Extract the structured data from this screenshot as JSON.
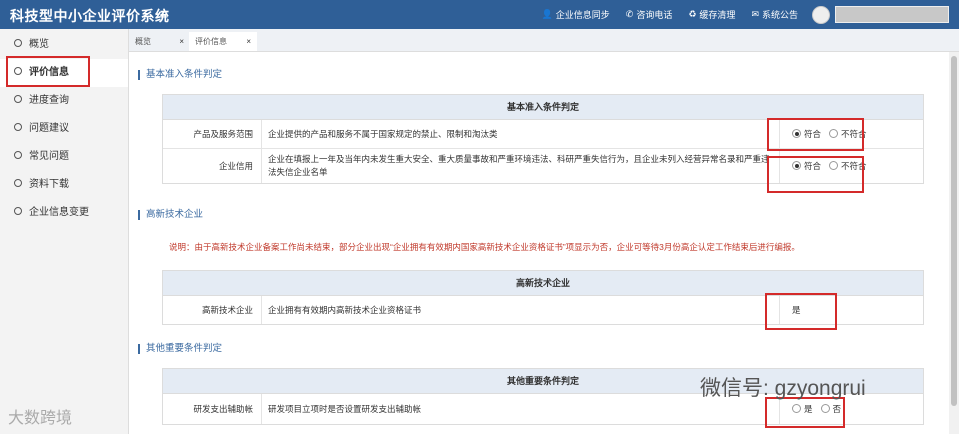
{
  "app": {
    "title": "科技型中小企业评价系统",
    "menu_icon": "hamburger-icon"
  },
  "topnav": [
    {
      "icon": "user-icon",
      "glyph": "👤",
      "label": "企业信息同步"
    },
    {
      "icon": "phone-icon",
      "glyph": "✆",
      "label": "咨询电话"
    },
    {
      "icon": "recycle-icon",
      "glyph": "♻",
      "label": "缓存清理"
    },
    {
      "icon": "notice-icon",
      "glyph": "✉",
      "label": "系统公告"
    }
  ],
  "sidebar": {
    "items": [
      {
        "label": "概览"
      },
      {
        "label": "评价信息"
      },
      {
        "label": "进度查询"
      },
      {
        "label": "问题建议"
      },
      {
        "label": "常见问题"
      },
      {
        "label": "资料下载"
      },
      {
        "label": "企业信息变更"
      }
    ]
  },
  "tabs": [
    {
      "label": "概览",
      "close": "×"
    },
    {
      "label": "评价信息",
      "close": "×"
    }
  ],
  "sections": {
    "basic": {
      "title": "基本准入条件判定",
      "table_header": "基本准入条件判定",
      "rows": [
        {
          "label": "产品及服务范围",
          "desc": "企业提供的产品和服务不属于国家规定的禁止、限制和淘汰类",
          "opt1": "符合",
          "opt2": "不符合",
          "selected": "符合"
        },
        {
          "label": "企业信用",
          "desc": "企业在填报上一年及当年内未发生重大安全、重大质量事故和严重环境违法、科研严重失信行为，且企业未列入经营异常名录和严重违法失信企业名单",
          "opt1": "符合",
          "opt2": "不符合",
          "selected": "符合"
        }
      ]
    },
    "hitech": {
      "title": "高新技术企业",
      "note": "说明：由于高新技术企业备案工作尚未结束，部分企业出现“企业拥有有效期内国家高新技术企业资格证书”项显示为否，企业可等待3月份高企认定工作结束后进行编报。",
      "table_header": "高新技术企业",
      "rows": [
        {
          "label": "高新技术企业",
          "desc": "企业拥有有效期内高新技术企业资格证书",
          "value": "是"
        }
      ]
    },
    "other": {
      "title": "其他重要条件判定",
      "table_header": "其他重要条件判定",
      "rows": [
        {
          "label": "研发支出辅助帐",
          "desc": "研发项目立项时是否设置研发支出辅助帐",
          "opt1": "是",
          "opt2": "否",
          "selected": ""
        }
      ]
    }
  },
  "watermarks": {
    "left": "大数跨境",
    "right": "微信号: gzyongrui"
  }
}
